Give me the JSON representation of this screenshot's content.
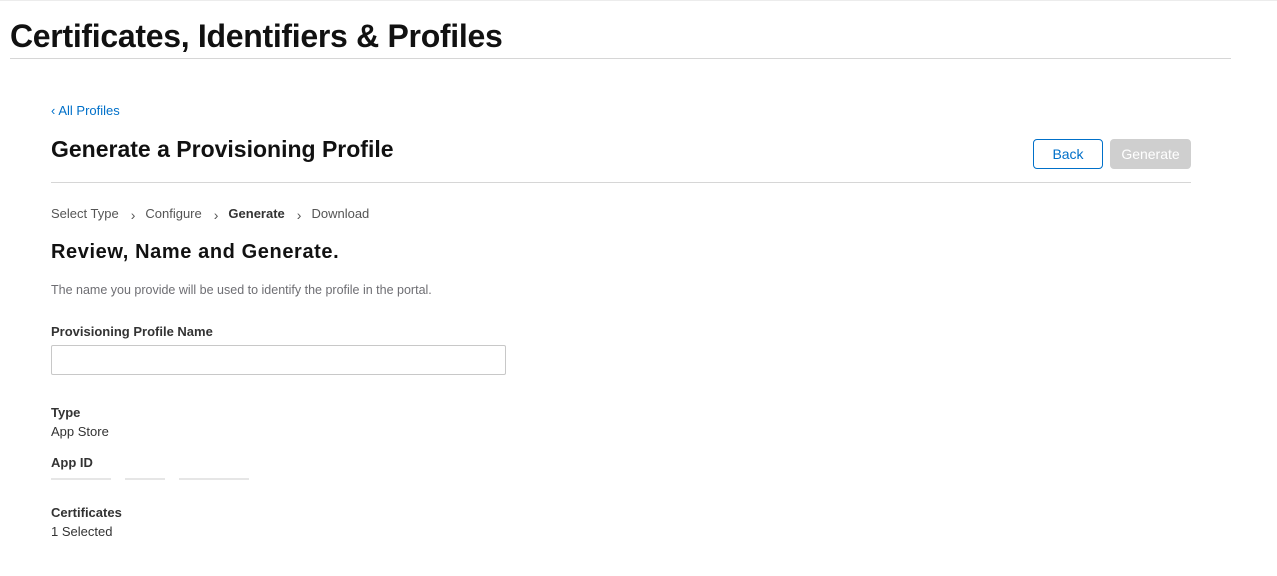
{
  "header": {
    "title": "Certificates, Identifiers & Profiles"
  },
  "nav": {
    "back_link_chevron": "‹",
    "back_link_label": "All Profiles"
  },
  "section": {
    "title": "Generate a Provisioning Profile"
  },
  "buttons": {
    "back_label": "Back",
    "generate_label": "Generate"
  },
  "steps": [
    {
      "label": "Select Type",
      "current": false
    },
    {
      "label": "Configure",
      "current": false
    },
    {
      "label": "Generate",
      "current": true
    },
    {
      "label": "Download",
      "current": false
    }
  ],
  "step_separator": "›",
  "review": {
    "title": "Review, Name and Generate.",
    "hint": "The name you provide will be used to identify the profile in the portal."
  },
  "form": {
    "profile_name_label": "Provisioning Profile Name",
    "profile_name_value": "",
    "profile_name_placeholder": ""
  },
  "details": {
    "type_label": "Type",
    "type_value": "App Store",
    "app_id_label": "App ID",
    "certificates_label": "Certificates",
    "certificates_value": "1 Selected"
  },
  "colors": {
    "link": "#0070c9",
    "disabled_button": "#cfcfcf",
    "divider": "#d6d6d6"
  }
}
